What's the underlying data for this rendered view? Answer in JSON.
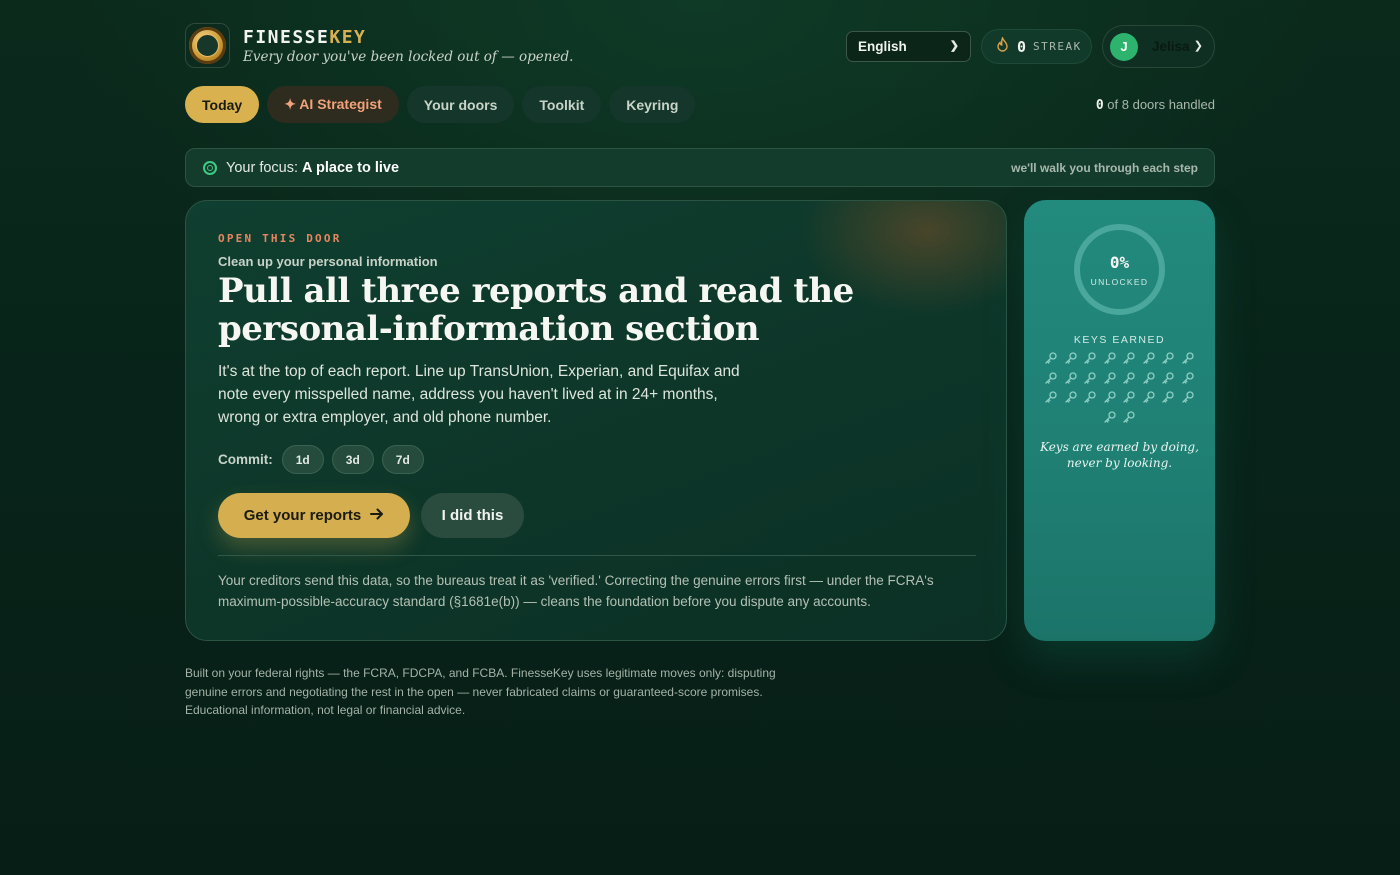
{
  "brand": {
    "name_part1": "FINESSE",
    "name_part2": "KEY",
    "tagline": "Every door you've been locked out of — opened."
  },
  "header": {
    "language": "English",
    "streak": {
      "count": "0",
      "label": "STREAK"
    },
    "user": {
      "initial": "J",
      "name": "Jelisa"
    }
  },
  "tabs": [
    {
      "label": "Today",
      "active": true
    },
    {
      "label": "✦ AI Strategist"
    },
    {
      "label": "Your doors"
    },
    {
      "label": "Toolkit"
    },
    {
      "label": "Keyring"
    }
  ],
  "progress": {
    "handled": "0",
    "rest": " of 8 doors handled"
  },
  "focus": {
    "prefix": "Your focus: ",
    "value": "A place to live",
    "hint": "we'll walk you through each step"
  },
  "card": {
    "eyebrow": "OPEN THIS DOOR",
    "subhead": "Clean up your personal information",
    "headline": "Pull all three reports and read the personal-information section",
    "body": "It's at the top of each report. Line up TransUnion, Experian, and Equifax and note every misspelled name, address you haven't lived at in 24+ months, wrong or extra employer, and old phone number.",
    "commit_label": "Commit:",
    "commit_options": [
      "1d",
      "3d",
      "7d"
    ],
    "primary_button": "Get your reports",
    "secondary_button": "I did this",
    "footnote": "Your creditors send this data, so the bureaus treat it as 'verified.' Correcting the genuine errors first — under the FCRA's maximum-possible-accuracy standard (§1681e(b)) — cleans the foundation before you dispute any accounts."
  },
  "side": {
    "percent": "0%",
    "unlocked_label": "UNLOCKED",
    "keys_title": "KEYS EARNED",
    "keys_total": 26,
    "keys_earned": 0,
    "note": "Keys are earned by doing, never by looking."
  },
  "legal": "Built on your federal rights — the FCRA, FDCPA, and FCBA. FinesseKey uses legitimate moves only: disputing genuine errors and negotiating the rest in the open — never fabricated claims or guaranteed-score promises. Educational information, not legal or financial advice.",
  "colors": {
    "accent_gold": "#d4ae4f",
    "teal_panel": "#238a7e",
    "background": "#0b2a1c",
    "eyebrow_orange": "#e8865f"
  }
}
